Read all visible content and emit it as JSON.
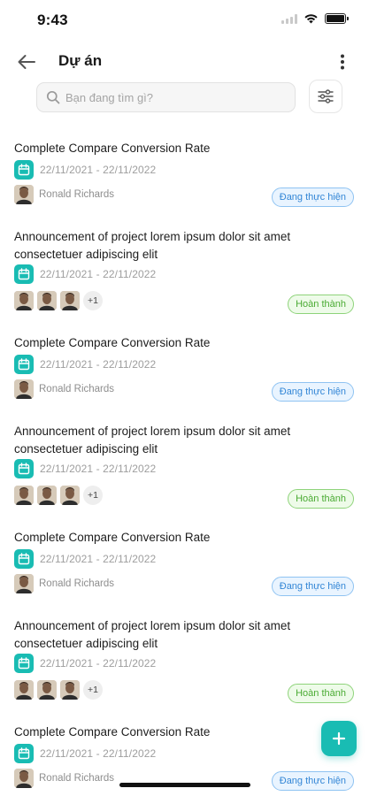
{
  "status_bar": {
    "time": "9:43"
  },
  "header": {
    "title": "Dự án"
  },
  "search": {
    "placeholder": "Bạn đang tìm gì?"
  },
  "colors": {
    "accent": "#19BCB3",
    "in_progress": "#3386D6",
    "done": "#4AAB33"
  },
  "icons": {
    "back": "arrow-left-icon",
    "more": "more-vertical-icon",
    "search": "search-icon",
    "filter": "sliders-icon",
    "calendar": "calendar-icon",
    "add": "plus-icon"
  },
  "projects": [
    {
      "title": "Complete Compare Conversion Rate",
      "date_range": "22/11/2021 - 22/11/2022",
      "person": "Ronald Richards",
      "status": "Đang thực hiện"
    },
    {
      "title": "Announcement of project lorem ipsum dolor sit amet consectetuer adipiscing elit",
      "date_range": "22/11/2021 - 22/11/2022",
      "extra_members": "+1",
      "status": "Hoàn thành"
    },
    {
      "title": "Complete Compare Conversion Rate",
      "date_range": "22/11/2021 - 22/11/2022",
      "person": "Ronald Richards",
      "status": "Đang thực hiện"
    },
    {
      "title": "Announcement of project lorem ipsum dolor sit amet consectetuer adipiscing elit",
      "date_range": "22/11/2021 - 22/11/2022",
      "extra_members": "+1",
      "status": "Hoàn thành"
    },
    {
      "title": "Complete Compare Conversion Rate",
      "date_range": "22/11/2021 - 22/11/2022",
      "person": "Ronald Richards",
      "status": "Đang thực hiện"
    },
    {
      "title": "Announcement of project lorem ipsum dolor sit amet consectetuer adipiscing elit",
      "date_range": "22/11/2021 - 22/11/2022",
      "extra_members": "+1",
      "status": "Hoàn thành"
    },
    {
      "title": "Complete Compare Conversion Rate",
      "date_range": "22/11/2021 - 22/11/2022",
      "person": "Ronald Richards",
      "status": "Đang thực hiện"
    }
  ]
}
